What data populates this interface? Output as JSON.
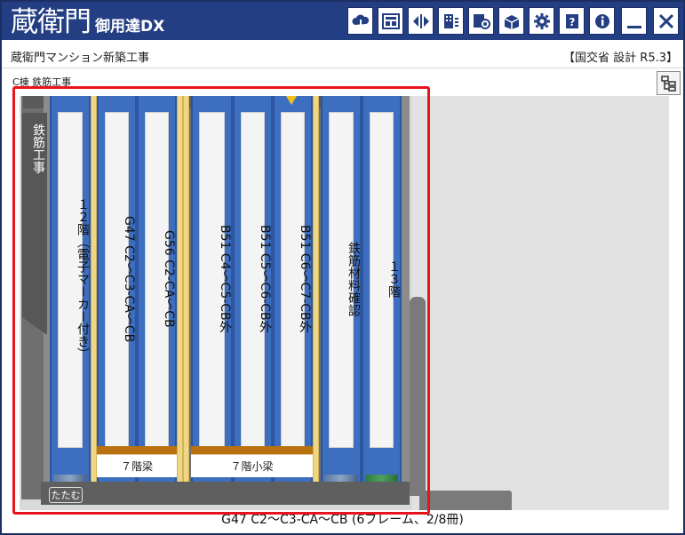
{
  "app": {
    "logo_main": "蔵衛門",
    "logo_sub": "御用達DX"
  },
  "toolbar": {
    "buttons": [
      {
        "icon": "cloud-sync-icon"
      },
      {
        "icon": "photo-board-icon"
      },
      {
        "icon": "split-arrows-icon"
      },
      {
        "icon": "building-list-icon"
      },
      {
        "icon": "settings-document-icon"
      },
      {
        "icon": "shared-box-icon"
      },
      {
        "icon": "gear-icon"
      },
      {
        "icon": "manual-book-icon"
      },
      {
        "icon": "info-icon"
      },
      {
        "icon": "minimize-icon"
      },
      {
        "icon": "close-icon"
      }
    ]
  },
  "project": {
    "name": "蔵衛門マンション新築工事",
    "standard": "【国交省 設計 R5.3】"
  },
  "breadcrumb": "C棟  鉄筋工事",
  "shelf": {
    "side_tab": "鉄筋工事",
    "binders": [
      {
        "title": "１２階（電子マーカー付き）"
      },
      {
        "title": "G47 C2～C3-CA～CB"
      },
      {
        "title": "G56 C2-CA～CB"
      },
      {
        "title": "B51 C4～C5-CB外"
      },
      {
        "title": "B51 C5～C6-CB外"
      },
      {
        "title": "B51 C6～C7-CB外"
      },
      {
        "title": "鉄筋材料確認"
      },
      {
        "title": "１３階"
      }
    ],
    "groups": [
      {
        "label": "７階梁"
      },
      {
        "label": "７階小梁"
      }
    ],
    "fold_button": "たたむ"
  },
  "status": "G47 C2～C3-CA～CB (6フレーム、2/8冊)",
  "colors": {
    "title_bar": "#233e82",
    "binder_blue": "#3d6ec0",
    "divider_yellow": "#efd683",
    "group_band": "#b8720f",
    "highlight_red": "#e8141b"
  }
}
